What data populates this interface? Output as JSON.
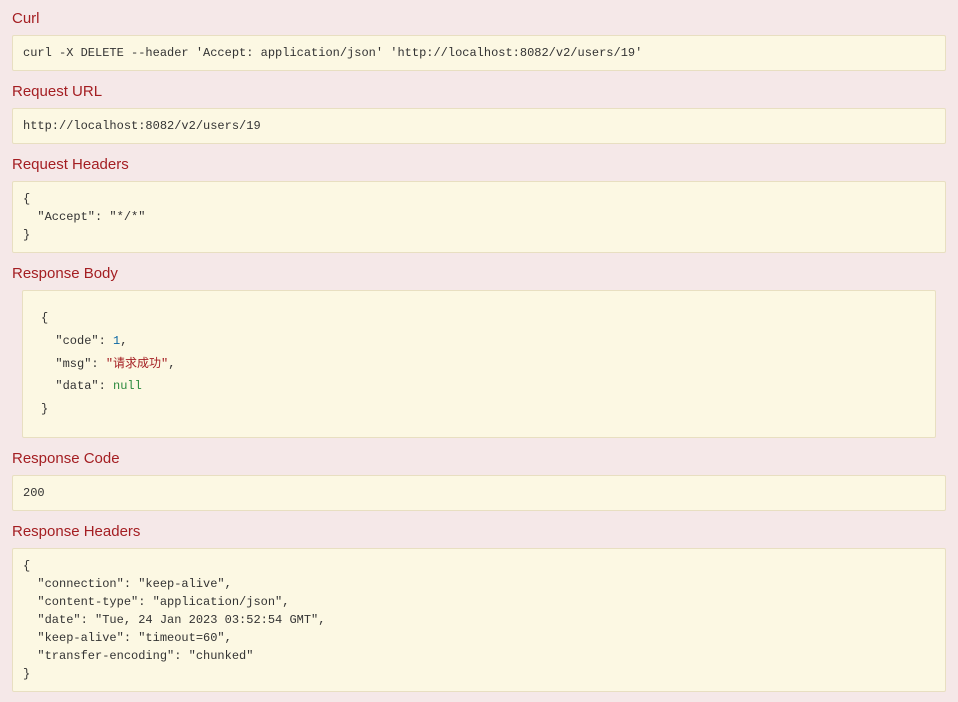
{
  "sections": {
    "curl": {
      "title": "Curl",
      "content": "curl -X DELETE --header 'Accept: application/json' 'http://localhost:8082/v2/users/19'"
    },
    "request_url": {
      "title": "Request URL",
      "content": "http://localhost:8082/v2/users/19"
    },
    "request_headers": {
      "title": "Request Headers",
      "content": "{\n  \"Accept\": \"*/*\"\n}"
    },
    "response_body": {
      "title": "Response Body",
      "json": {
        "code": 1,
        "msg": "请求成功",
        "data": null
      },
      "display": {
        "open": "{",
        "line_code_key": "\"code\"",
        "line_code_sep": ": ",
        "line_code_val": "1",
        "line_code_trail": ",",
        "line_msg_key": "\"msg\"",
        "line_msg_sep": ": ",
        "line_msg_val": "\"请求成功\"",
        "line_msg_trail": ",",
        "line_data_key": "\"data\"",
        "line_data_sep": ": ",
        "line_data_val": "null",
        "close": "}"
      }
    },
    "response_code": {
      "title": "Response Code",
      "content": "200"
    },
    "response_headers": {
      "title": "Response Headers",
      "content": "{\n  \"connection\": \"keep-alive\",\n  \"content-type\": \"application/json\",\n  \"date\": \"Tue, 24 Jan 2023 03:52:54 GMT\",\n  \"keep-alive\": \"timeout=60\",\n  \"transfer-encoding\": \"chunked\"\n}",
      "json": {
        "connection": "keep-alive",
        "content-type": "application/json",
        "date": "Tue, 24 Jan 2023 03:52:54 GMT",
        "keep-alive": "timeout=60",
        "transfer-encoding": "chunked"
      }
    }
  }
}
